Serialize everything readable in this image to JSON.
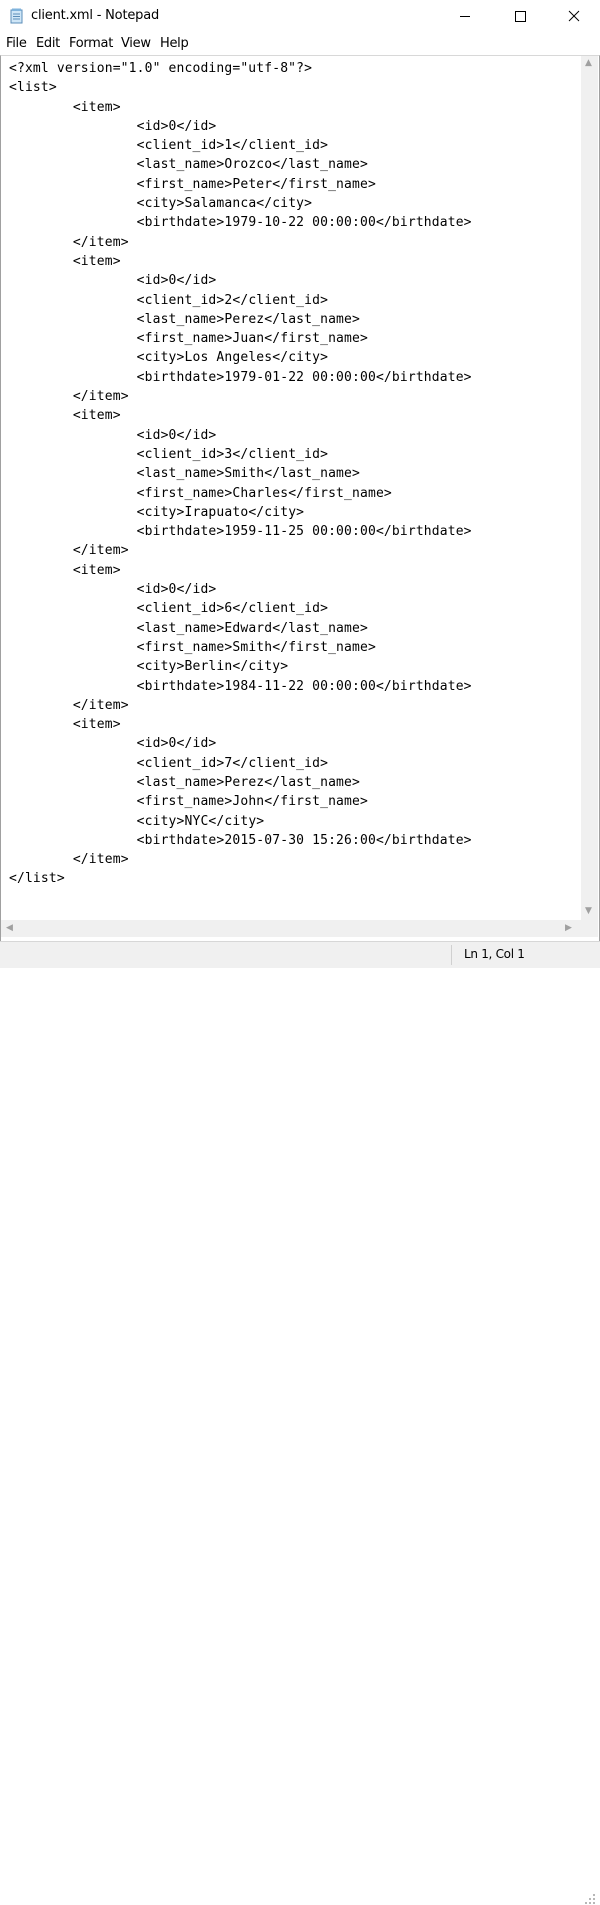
{
  "window": {
    "title": "client.xml - Notepad",
    "icon": "notepad-icon"
  },
  "menu": {
    "file": "File",
    "edit": "Edit",
    "format": "Format",
    "view": "View",
    "help": "Help"
  },
  "editor": {
    "content": "<?xml version=\"1.0\" encoding=\"utf-8\"?>\n<list>\n\t<item>\n\t\t<id>0</id>\n\t\t<client_id>1</client_id>\n\t\t<last_name>Orozco</last_name>\n\t\t<first_name>Peter</first_name>\n\t\t<city>Salamanca</city>\n\t\t<birthdate>1979-10-22 00:00:00</birthdate>\n\t</item>\n\t<item>\n\t\t<id>0</id>\n\t\t<client_id>2</client_id>\n\t\t<last_name>Perez</last_name>\n\t\t<first_name>Juan</first_name>\n\t\t<city>Los Angeles</city>\n\t\t<birthdate>1979-01-22 00:00:00</birthdate>\n\t</item>\n\t<item>\n\t\t<id>0</id>\n\t\t<client_id>3</client_id>\n\t\t<last_name>Smith</last_name>\n\t\t<first_name>Charles</first_name>\n\t\t<city>Irapuato</city>\n\t\t<birthdate>1959-11-25 00:00:00</birthdate>\n\t</item>\n\t<item>\n\t\t<id>0</id>\n\t\t<client_id>6</client_id>\n\t\t<last_name>Edward</last_name>\n\t\t<first_name>Smith</first_name>\n\t\t<city>Berlin</city>\n\t\t<birthdate>1984-11-22 00:00:00</birthdate>\n\t</item>\n\t<item>\n\t\t<id>0</id>\n\t\t<client_id>7</client_id>\n\t\t<last_name>Perez</last_name>\n\t\t<first_name>John</first_name>\n\t\t<city>NYC</city>\n\t\t<birthdate>2015-07-30 15:26:00</birthdate>\n\t</item>\n</list>"
  },
  "status": {
    "position": "Ln 1, Col 1"
  }
}
